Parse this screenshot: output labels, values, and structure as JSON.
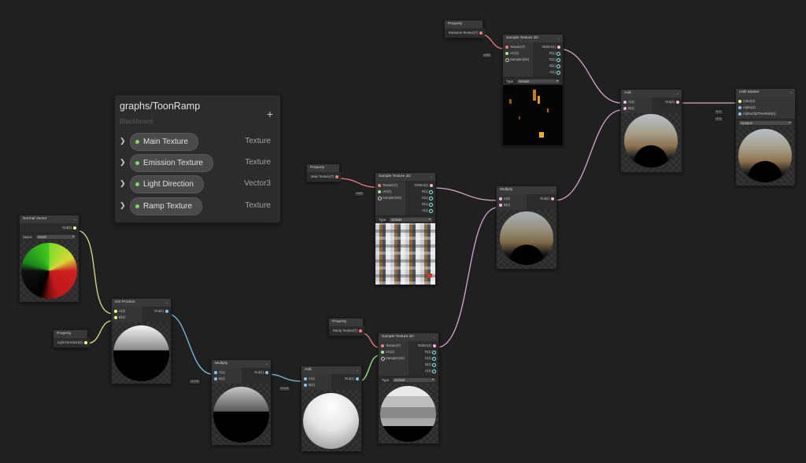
{
  "blackboard": {
    "title": "graphs/ToonRamp",
    "subtitle": "Blackboard",
    "add_label": "+",
    "properties": [
      {
        "name": "Main Texture",
        "type": "Texture"
      },
      {
        "name": "Emission Texture",
        "type": "Texture"
      },
      {
        "name": "Light Direction",
        "type": "Vector3"
      },
      {
        "name": "Ramp Texture",
        "type": "Texture"
      }
    ]
  },
  "nodes": {
    "prop_emission": {
      "title": "Property",
      "out": "Emission Texture(T)"
    },
    "prop_main": {
      "title": "Property",
      "out": "Main Texture(T)"
    },
    "prop_ramp": {
      "title": "Property",
      "out": "Ramp Texture(T)"
    },
    "prop_light": {
      "title": "Property",
      "out": "Light Direction(3)"
    },
    "normal_vector": {
      "title": "Normal Vector",
      "out": "Out(3)",
      "space_label": "Space",
      "space_value": "World"
    },
    "dot_product": {
      "title": "Dot Product",
      "in_a": "A(3)",
      "in_b": "B(3)",
      "out": "Out(1)"
    },
    "multiply_1": {
      "title": "Multiply",
      "in_a": "A(1)",
      "in_b": "B(1)",
      "out": "Out(1)",
      "b_value": "X 0.5"
    },
    "add_1": {
      "title": "Add",
      "in_a": "A(1)",
      "in_b": "B(1)",
      "out": "Out(1)",
      "b_value": "X 0.5"
    },
    "sample_emission": {
      "title": "Sample Texture 2D",
      "inputs": [
        "Texture(T)",
        "UV(2)",
        "Sampler(SS)"
      ],
      "outputs": [
        "RGBA(4)",
        "R(1)",
        "G(1)",
        "B(1)",
        "A(1)"
      ],
      "type_label": "Type",
      "type_value": "Default",
      "uv_value": "UV0"
    },
    "sample_main": {
      "title": "Sample Texture 2D",
      "inputs": [
        "Texture(T)",
        "UV(2)",
        "Sampler(SS)"
      ],
      "outputs": [
        "RGBA(4)",
        "R(1)",
        "G(1)",
        "B(1)",
        "A(1)"
      ],
      "type_label": "Type",
      "type_value": "Default",
      "uv_value": "UV0"
    },
    "sample_ramp": {
      "title": "Sample Texture 2D",
      "inputs": [
        "Texture(T)",
        "UV(2)",
        "Sampler(SS)"
      ],
      "outputs": [
        "RGBA(4)",
        "R(1)",
        "G(1)",
        "B(1)",
        "A(1)"
      ],
      "type_label": "Type",
      "type_value": "Default"
    },
    "multiply_2": {
      "title": "Multiply",
      "in_a": "A(4)",
      "in_b": "B(4)",
      "out": "Out(4)"
    },
    "add_2": {
      "title": "Add",
      "in_a": "A(4)",
      "in_b": "B(4)",
      "out": "Out(4)"
    },
    "unlit_master": {
      "title": "Unlit Master",
      "inputs": [
        "Color(3)",
        "Alpha(1)",
        "AlphaClipThreshold(1)"
      ],
      "alpha_value": "X 1",
      "clip_value": "X 0",
      "preview_mode": "Opaque"
    }
  },
  "colors": {
    "background": "#202020",
    "node": "#2b2b2b",
    "texture_port": "#f07f7f",
    "vector1_port": "#8cc0f0",
    "vector3_port": "#f6ff9a",
    "vector4_port": "#f5b7e1",
    "uv_port": "#9af08c",
    "bb_dot": "#7fd86a"
  }
}
